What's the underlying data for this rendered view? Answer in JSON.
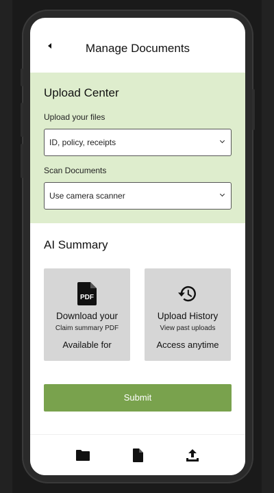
{
  "header": {
    "title": "Manage Documents"
  },
  "upload": {
    "title": "Upload Center",
    "files_label": "Upload your files",
    "files_value": "ID, policy, receipts",
    "scan_label": "Scan Documents",
    "scan_value": "Use camera scanner"
  },
  "summary": {
    "title": "AI Summary",
    "cards": [
      {
        "icon": "pdf-icon",
        "title": "Download your",
        "subtitle": "Claim summary PDF",
        "footer": "Available for"
      },
      {
        "icon": "history-icon",
        "title": "Upload History",
        "subtitle": "View past uploads",
        "footer": "Access anytime"
      }
    ]
  },
  "submit_label": "Submit",
  "nav": {
    "items": [
      "folder-icon",
      "file-icon",
      "upload-icon"
    ]
  },
  "colors": {
    "upload_bg": "#deedcd",
    "accent": "#79a24d",
    "card_bg": "#d6d6d6"
  }
}
